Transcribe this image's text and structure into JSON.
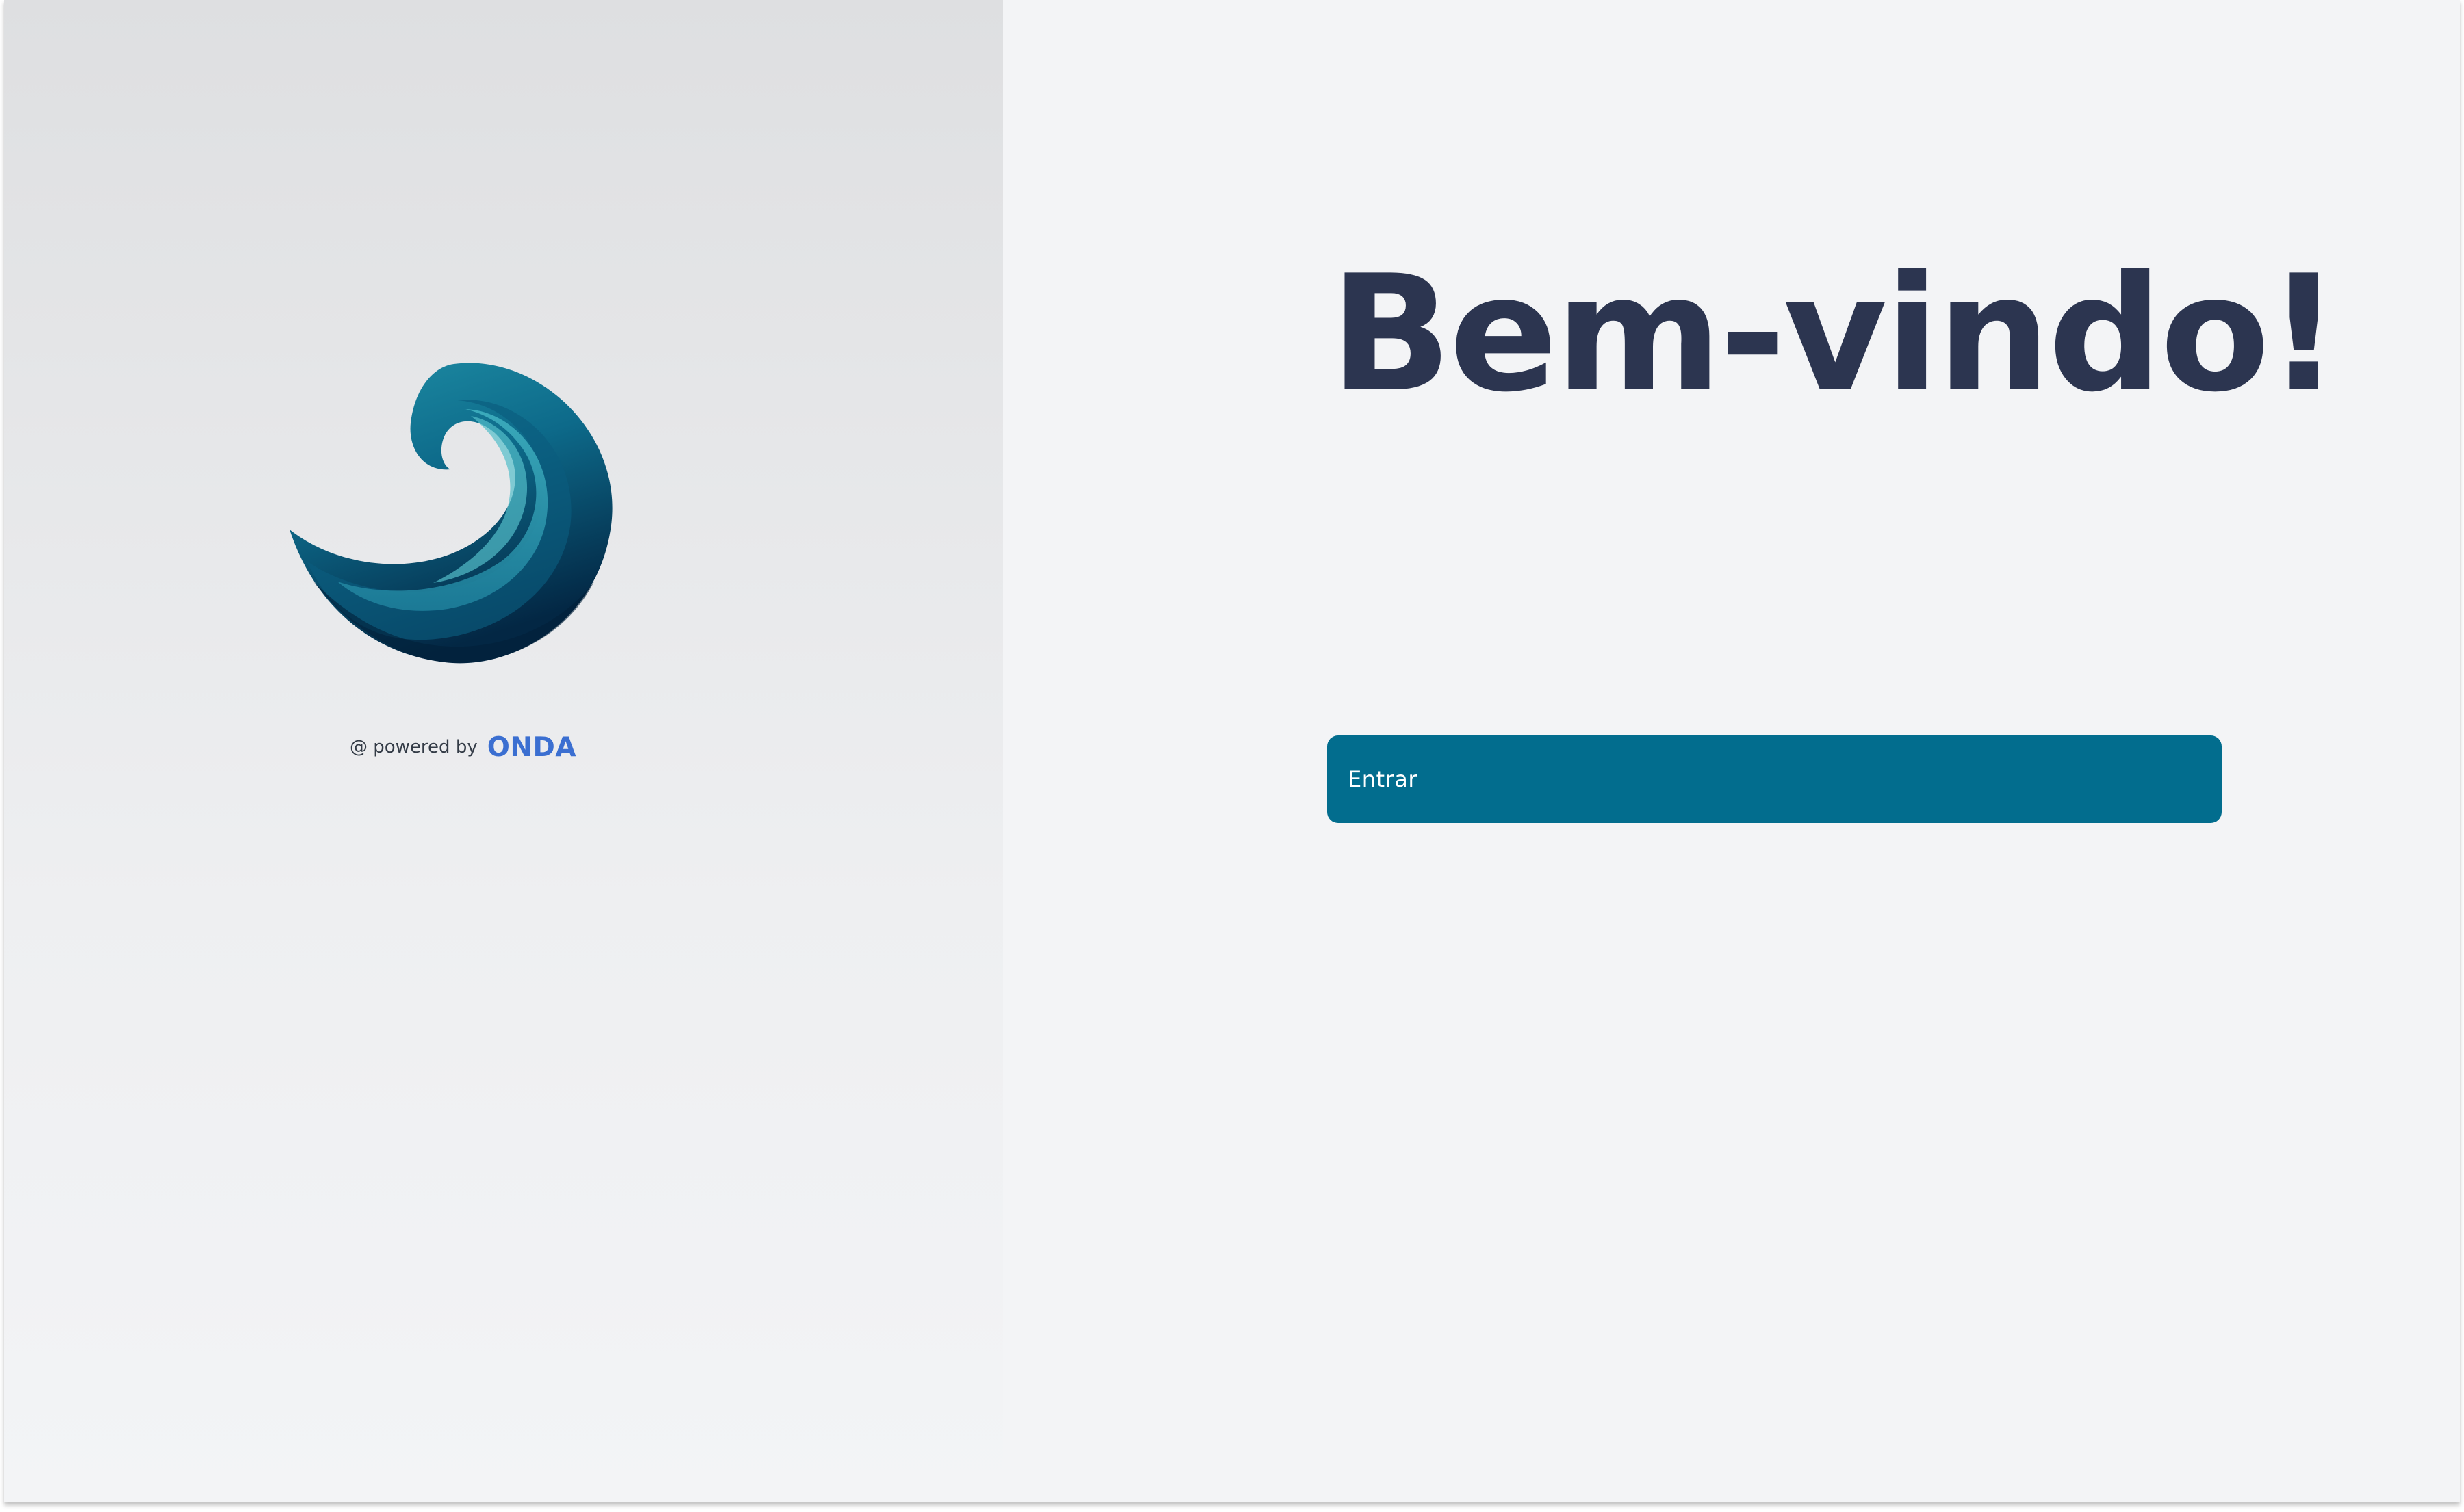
{
  "brand": {
    "logo_icon": "wave-logo-icon",
    "powered_by_text": "@ powered by",
    "powered_by_brand": "ONDA",
    "colors": {
      "brand_text": "#3b6fd1",
      "wave_light": "#2a9aae",
      "wave_dark": "#042d4d"
    }
  },
  "welcome": {
    "title": "Bem-vindo!",
    "color": "#2c3550"
  },
  "login": {
    "button_label": "Entrar",
    "button_color": "#026d8e"
  }
}
